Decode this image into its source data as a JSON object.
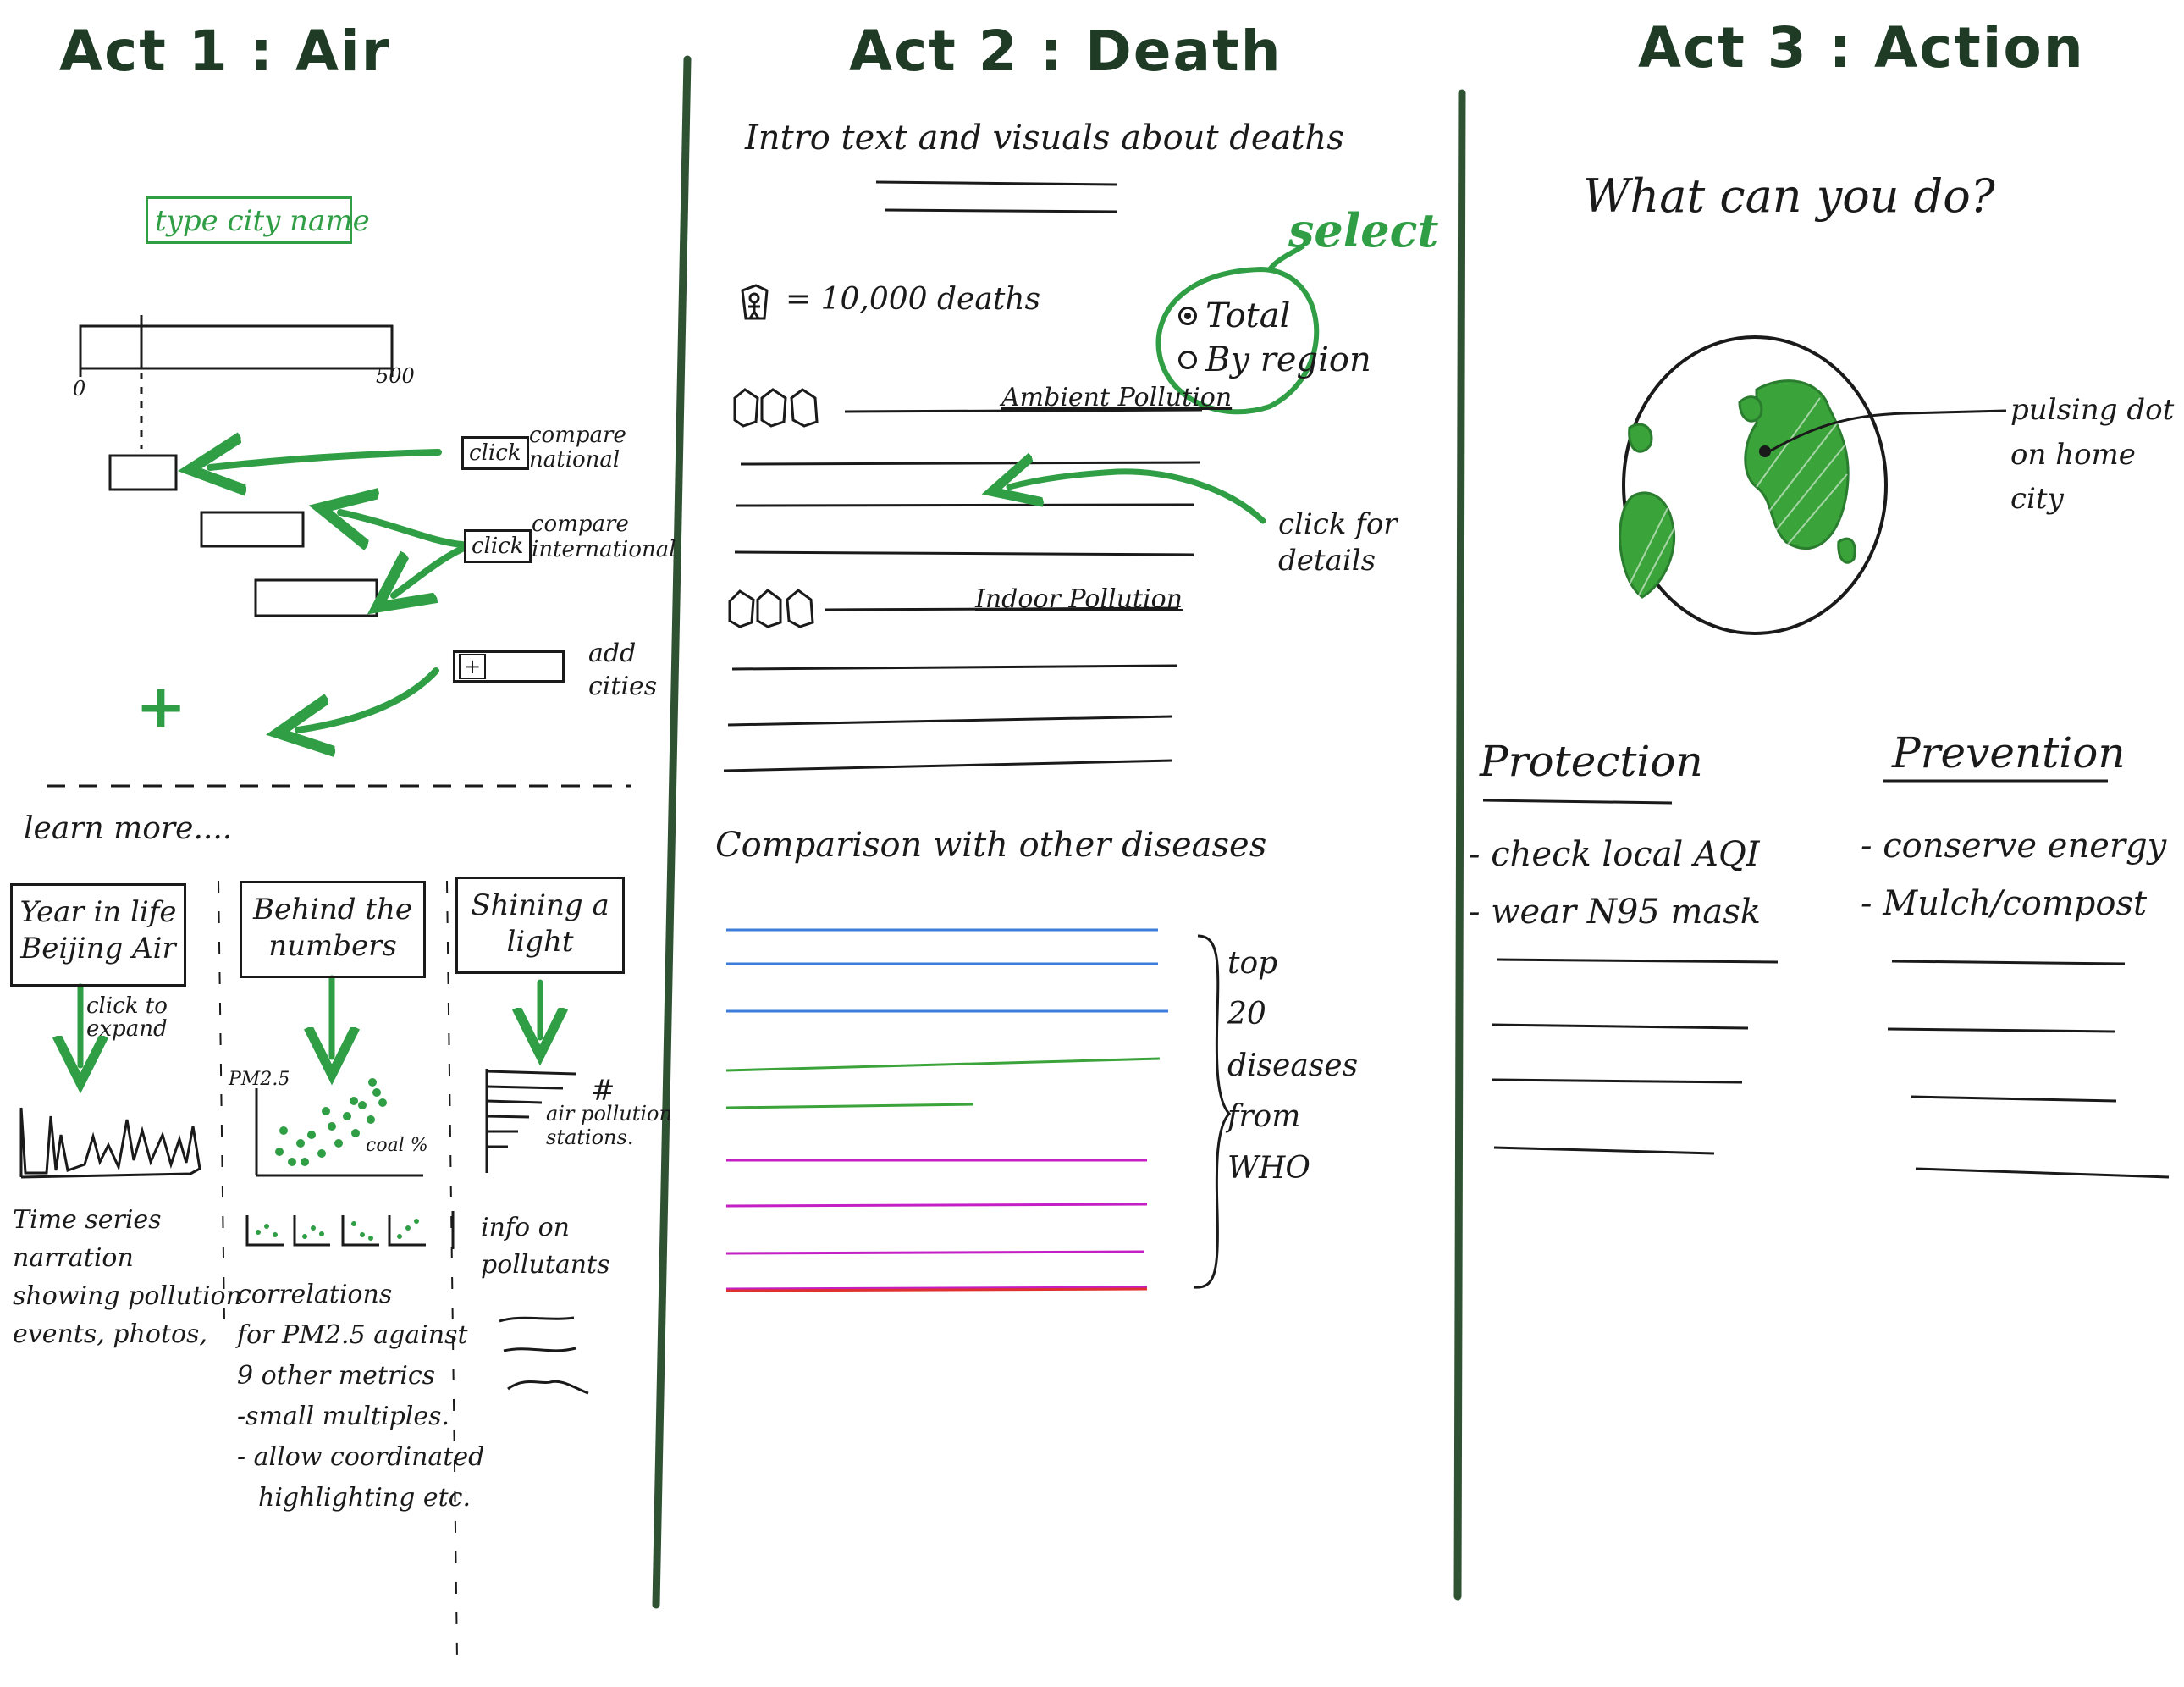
{
  "colors": {
    "divider": "#2f5233",
    "accent": "#2f9e44",
    "ink": "#1a1a1a",
    "blue": "#3b7dd8",
    "green": "#3aa33a",
    "magenta": "#c41fc4",
    "red": "#e03131"
  },
  "act1": {
    "title": "Act 1 : Air",
    "city_input_placeholder": "type city name",
    "scale_min": "0",
    "scale_max": "500",
    "compare_national_click": "click",
    "compare_national_label_1": "compare",
    "compare_national_label_2": "national",
    "compare_international_click": "click",
    "compare_international_label_1": "compare",
    "compare_international_label_2": "international",
    "add_button": "+",
    "add_cities_label_1": "add",
    "add_cities_label_2": "cities",
    "plus_icon": "+",
    "learn_more": "learn more....",
    "cards": [
      {
        "title_1": "Year in life",
        "title_2": "Beijing Air",
        "note_1": "click to",
        "note_2": "expand",
        "desc": [
          "Time series",
          "narration",
          "showing pollution",
          "events, photos,"
        ]
      },
      {
        "title_1": "Behind the",
        "title_2": "numbers",
        "y_label": "PM2.5",
        "x_label": "coal %",
        "desc": [
          "correlations",
          "for PM2.5 against",
          "9 other metrics",
          "-small multiples.",
          "- allow coordinated",
          "highlighting etc."
        ]
      },
      {
        "title_1": "Shining a",
        "title_2": "light",
        "chart_label": "#",
        "chart_note_1": "air pollution",
        "chart_note_2": "stations.",
        "desc": [
          "info on",
          "pollutants"
        ]
      }
    ]
  },
  "act2": {
    "title": "Act 2 : Death",
    "intro": "Intro text and visuals about deaths",
    "legend_equals": "= 10,000 deaths",
    "select_note": "select",
    "radio_total": "Total",
    "radio_by_region": "By region",
    "ambient_label": "Ambient Pollution",
    "indoor_label": "Indoor Pollution",
    "click_details_1": "click for",
    "click_details_2": "details",
    "comparison_heading": "Comparison with other diseases",
    "brace_note": [
      "top",
      "20",
      "diseases",
      "from",
      "WHO"
    ],
    "disease_line_colors": [
      "blue",
      "blue",
      "blue",
      "green",
      "green",
      "magenta",
      "magenta",
      "magenta",
      "magenta",
      "red"
    ]
  },
  "act3": {
    "title": "Act 3 : Action",
    "question": "What can you do?",
    "globe_note_1": "pulsing dot",
    "globe_note_2": "on home",
    "globe_note_3": "city",
    "protection_heading": "Protection",
    "protection_items": [
      "- check local AQI",
      "- wear N95 mask"
    ],
    "prevention_heading": "Prevention",
    "prevention_items": [
      "- conserve energy",
      "- Mulch/compost"
    ]
  }
}
